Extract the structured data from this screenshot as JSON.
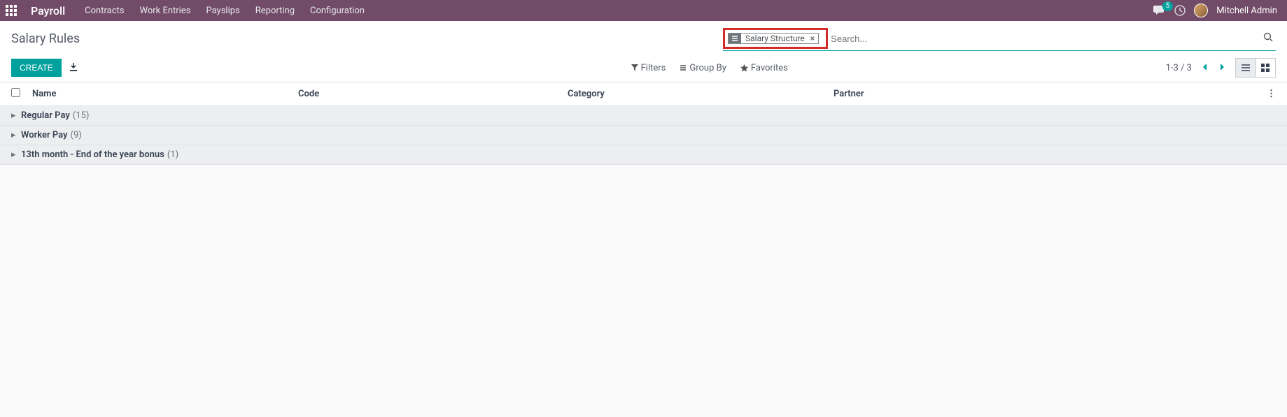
{
  "navbar": {
    "app_title": "Payroll",
    "menu": [
      "Contracts",
      "Work Entries",
      "Payslips",
      "Reporting",
      "Configuration"
    ],
    "message_count": "5",
    "user_name": "Mitchell Admin"
  },
  "control_panel": {
    "page_title": "Salary Rules",
    "search_tag": "Salary Structure",
    "search_placeholder": "Search...",
    "create_label": "CREATE",
    "filters_label": "Filters",
    "groupby_label": "Group By",
    "favorites_label": "Favorites",
    "pager": "1-3 / 3"
  },
  "table": {
    "columns": {
      "name": "Name",
      "code": "Code",
      "category": "Category",
      "partner": "Partner"
    },
    "groups": [
      {
        "label": "Regular Pay",
        "count": "(15)"
      },
      {
        "label": "Worker Pay",
        "count": "(9)"
      },
      {
        "label": "13th month - End of the year bonus",
        "count": "(1)"
      }
    ]
  }
}
